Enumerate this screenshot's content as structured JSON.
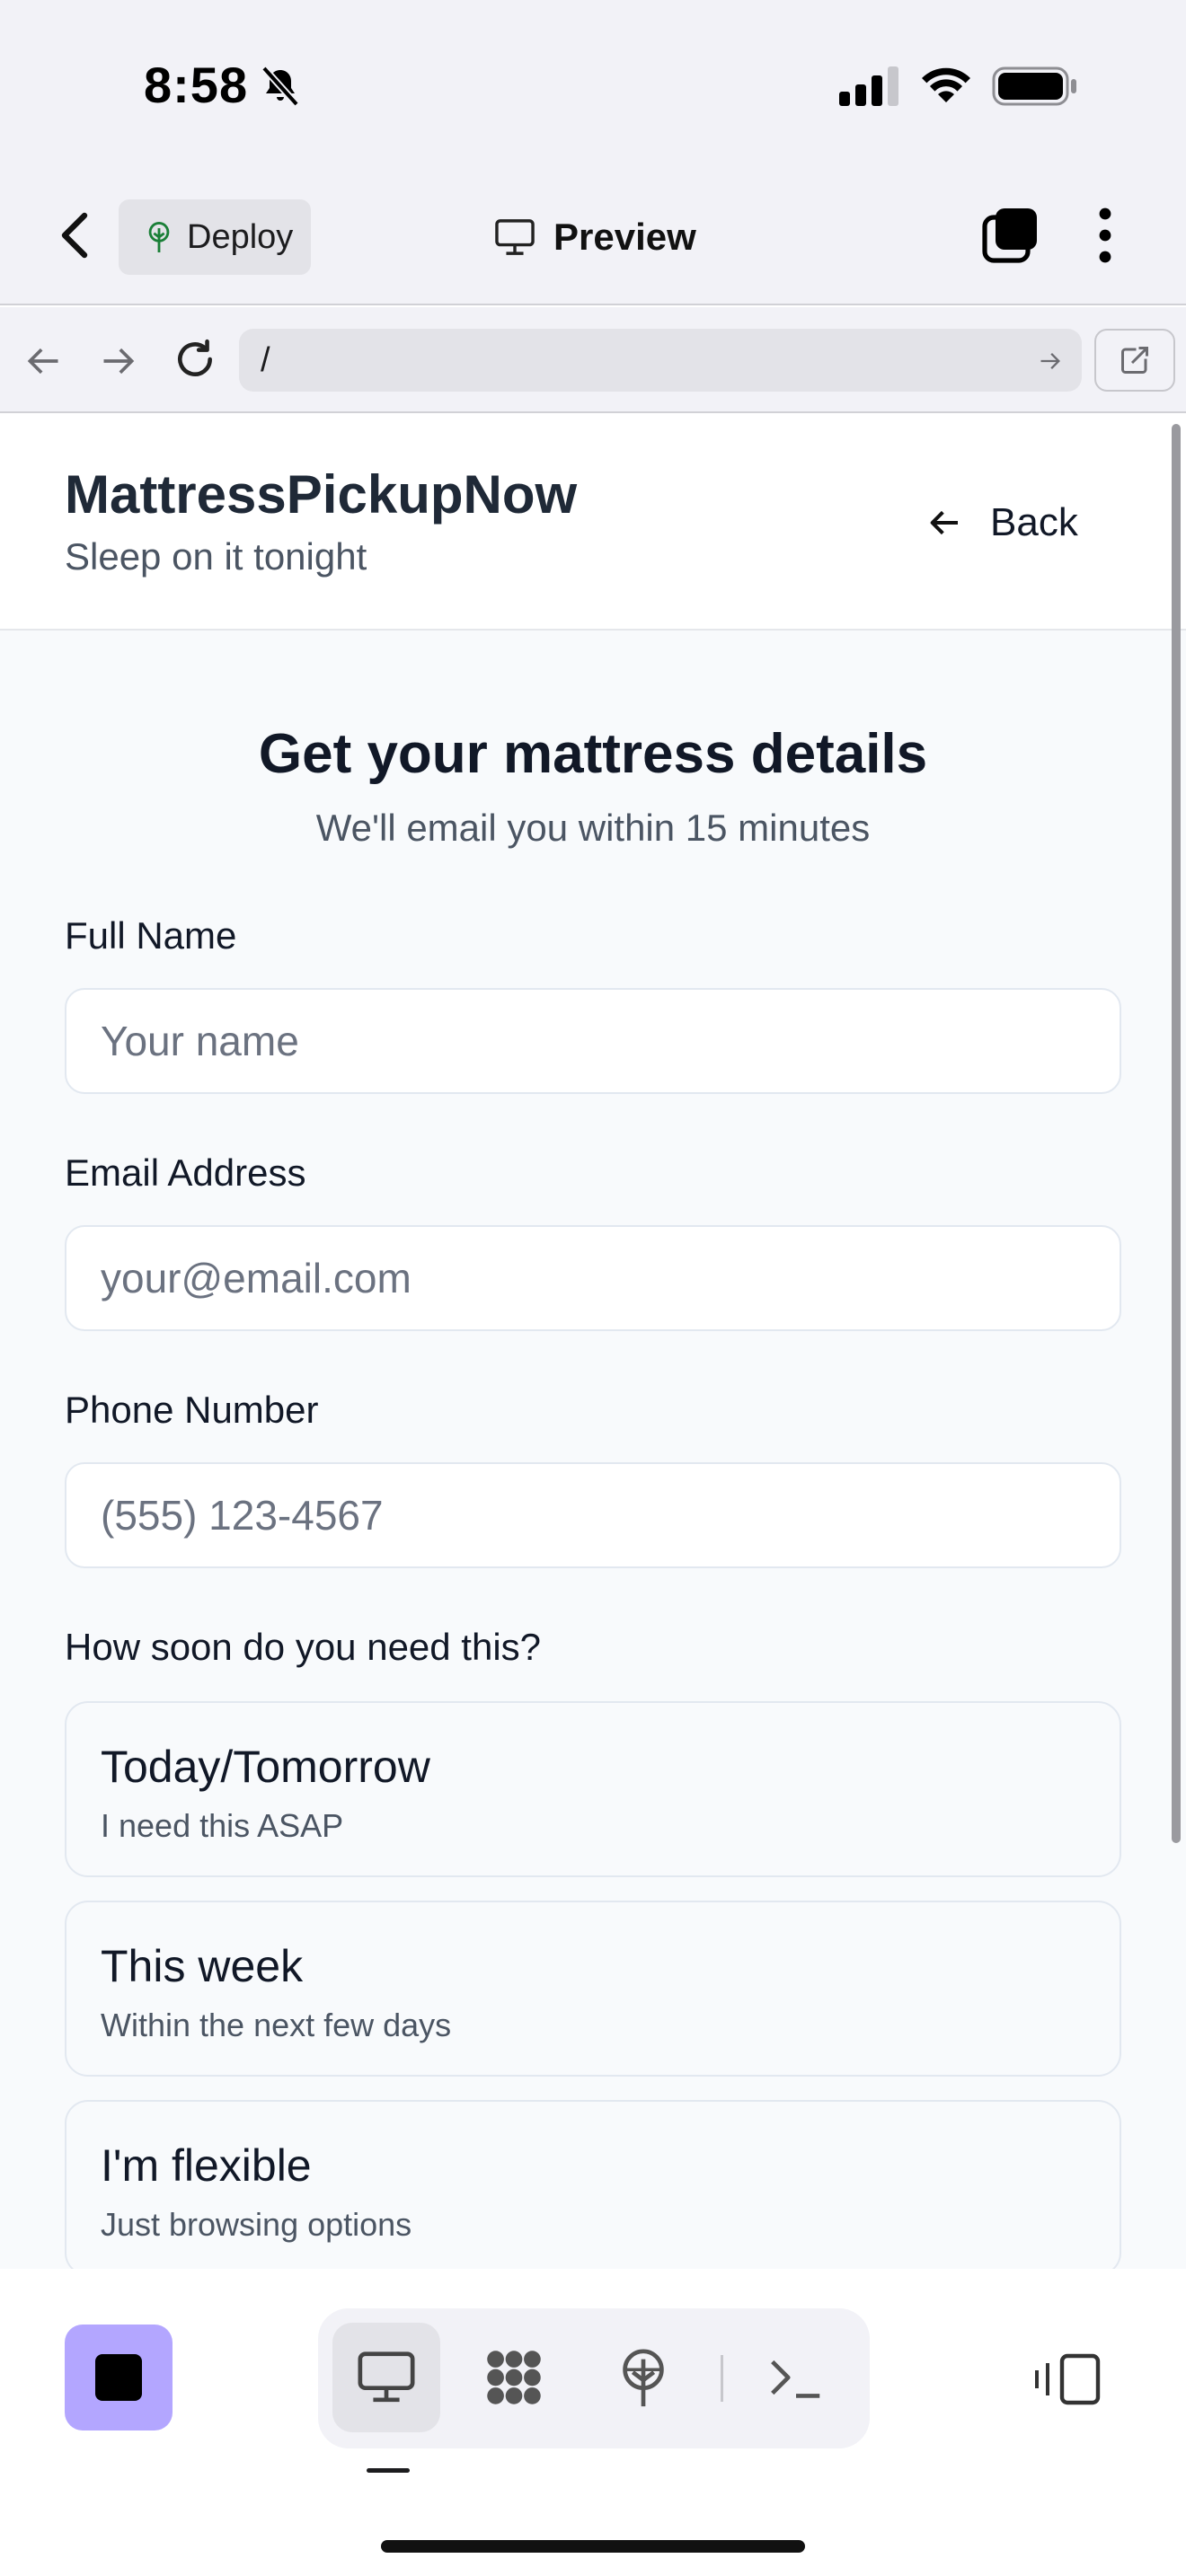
{
  "status_bar": {
    "time": "8:58",
    "icons": [
      "bell-slash-icon",
      "cellular-signal-icon",
      "wifi-icon",
      "battery-icon"
    ]
  },
  "app_header": {
    "back_icon": "chevron-left-icon",
    "deploy_label": "Deploy",
    "deploy_icon": "deploy-tree-icon",
    "title": "Preview",
    "title_icon": "monitor-icon",
    "tabs_icon": "tabs-icon",
    "more_icon": "more-vertical-icon"
  },
  "browser_bar": {
    "url": "/",
    "icons": [
      "arrow-left-icon",
      "arrow-right-icon",
      "reload-icon",
      "go-arrow-icon",
      "external-link-icon"
    ]
  },
  "site": {
    "brand": "MattressPickupNow",
    "tagline": "Sleep on it tonight",
    "back_label": "Back"
  },
  "form": {
    "heading": "Get your mattress details",
    "subheading": "We'll email you within 15 minutes",
    "full_name": {
      "label": "Full Name",
      "placeholder": "Your name",
      "value": ""
    },
    "email": {
      "label": "Email Address",
      "placeholder": "your@email.com",
      "value": ""
    },
    "phone": {
      "label": "Phone Number",
      "placeholder": "(555) 123-4567",
      "value": ""
    },
    "timing_question": "How soon do you need this?",
    "options": [
      {
        "title": "Today/Tomorrow",
        "description": "I need this ASAP"
      },
      {
        "title": "This week",
        "description": "Within the next few days"
      },
      {
        "title": "I'm flexible",
        "description": "Just browsing options"
      }
    ]
  },
  "bottom_bar": {
    "stop_icon": "stop-icon",
    "tools": [
      "preview-monitor-icon",
      "workflow-nodes-icon",
      "deploy-tree-icon",
      "terminal-icon"
    ],
    "active_tool": "preview-monitor-icon",
    "panel_icon": "panel-toggle-icon"
  },
  "colors": {
    "accent_purple": "#b3a6ff",
    "page_background": "#f8fafc",
    "text_primary": "#111827",
    "text_secondary": "#4b5563",
    "border": "#e2e8f0"
  }
}
